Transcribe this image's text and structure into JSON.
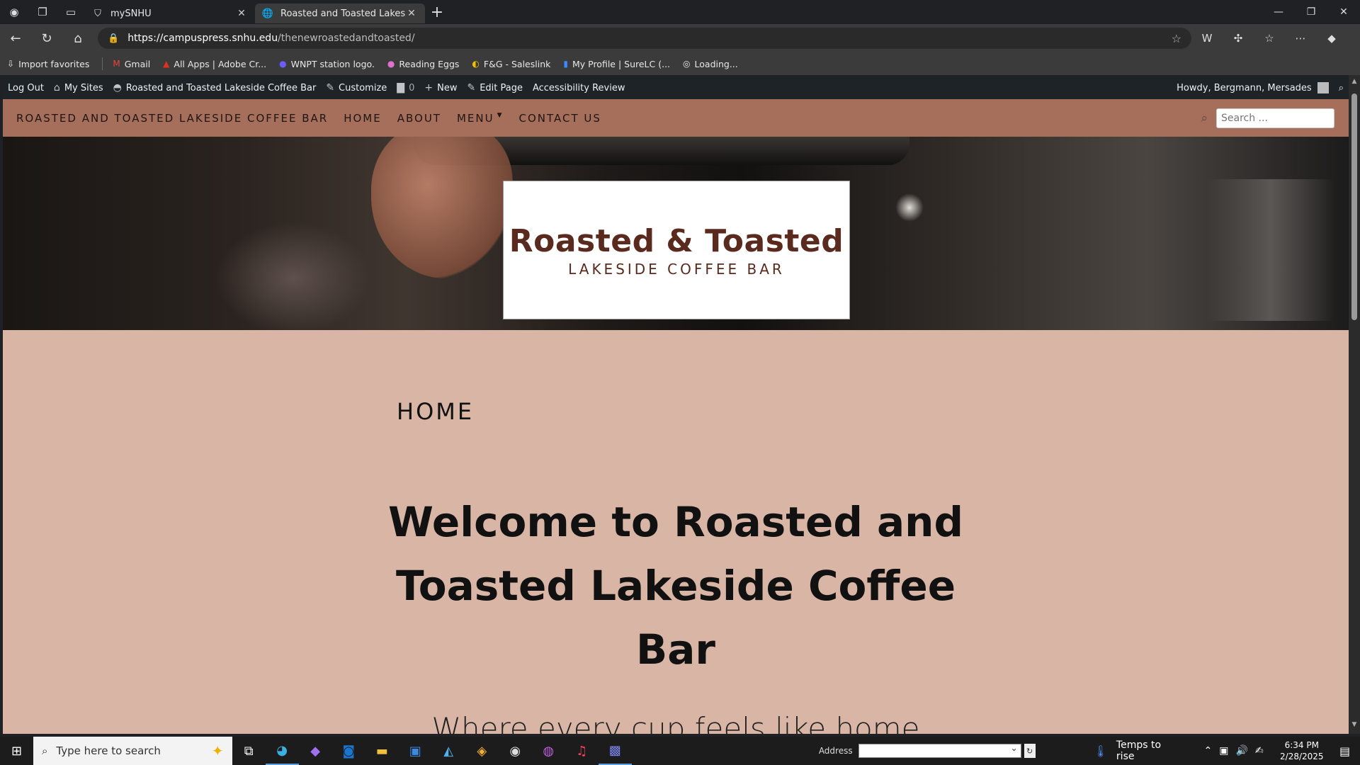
{
  "browser": {
    "tabs": [
      {
        "title": "mySNHU",
        "active": false
      },
      {
        "title": "Roasted and Toasted Lakeside Co",
        "active": true
      }
    ],
    "url_host": "https://campuspress.snhu.edu",
    "url_path": "/thenewroastedandtoasted/"
  },
  "bookmarks": [
    {
      "label": "Import favorites",
      "icon": "import-icon"
    },
    {
      "label": "Gmail",
      "icon": "gmail-icon"
    },
    {
      "label": "All Apps | Adobe Cr...",
      "icon": "adobe-icon"
    },
    {
      "label": "WNPT station logo.",
      "icon": "wnpt-icon"
    },
    {
      "label": "Reading Eggs",
      "icon": "egg-icon"
    },
    {
      "label": "F&G - Saleslink",
      "icon": "saleslink-icon"
    },
    {
      "label": "My Profile | SureLC (...",
      "icon": "surelc-icon"
    },
    {
      "label": "Loading...",
      "icon": "globe-icon"
    }
  ],
  "adminbar": {
    "logout": "Log Out",
    "my_sites": "My Sites",
    "site_name": "Roasted and Toasted Lakeside Coffee Bar",
    "customize": "Customize",
    "comments": "0",
    "new": "New",
    "edit_page": "Edit Page",
    "accessibility": "Accessibility Review",
    "howdy": "Howdy, Bergmann, Mersades"
  },
  "nav": {
    "brand": "ROASTED AND TOASTED LAKESIDE COFFEE BAR",
    "home": "HOME",
    "about": "ABOUT",
    "menu": "MENU",
    "contact": "CONTACT US",
    "search_placeholder": "Search ..."
  },
  "logo": {
    "main": "Roasted & Toasted",
    "sub": "LAKESIDE COFFEE BAR"
  },
  "content": {
    "page_label": "HOME",
    "headline": "Welcome to Roasted and Toasted Lakeside Coffee Bar",
    "tagline": "Where every cup feels like home"
  },
  "taskbar": {
    "search_placeholder": "Type here to search",
    "address_label": "Address",
    "weather": "Temps to rise",
    "time": "6:34 PM",
    "date": "2/28/2025"
  },
  "colors": {
    "nav_bg": "#a56f5b",
    "content_bg": "#d8b5a4",
    "logo_brown": "#5a2a1e",
    "adminbar_bg": "#1d2327"
  }
}
